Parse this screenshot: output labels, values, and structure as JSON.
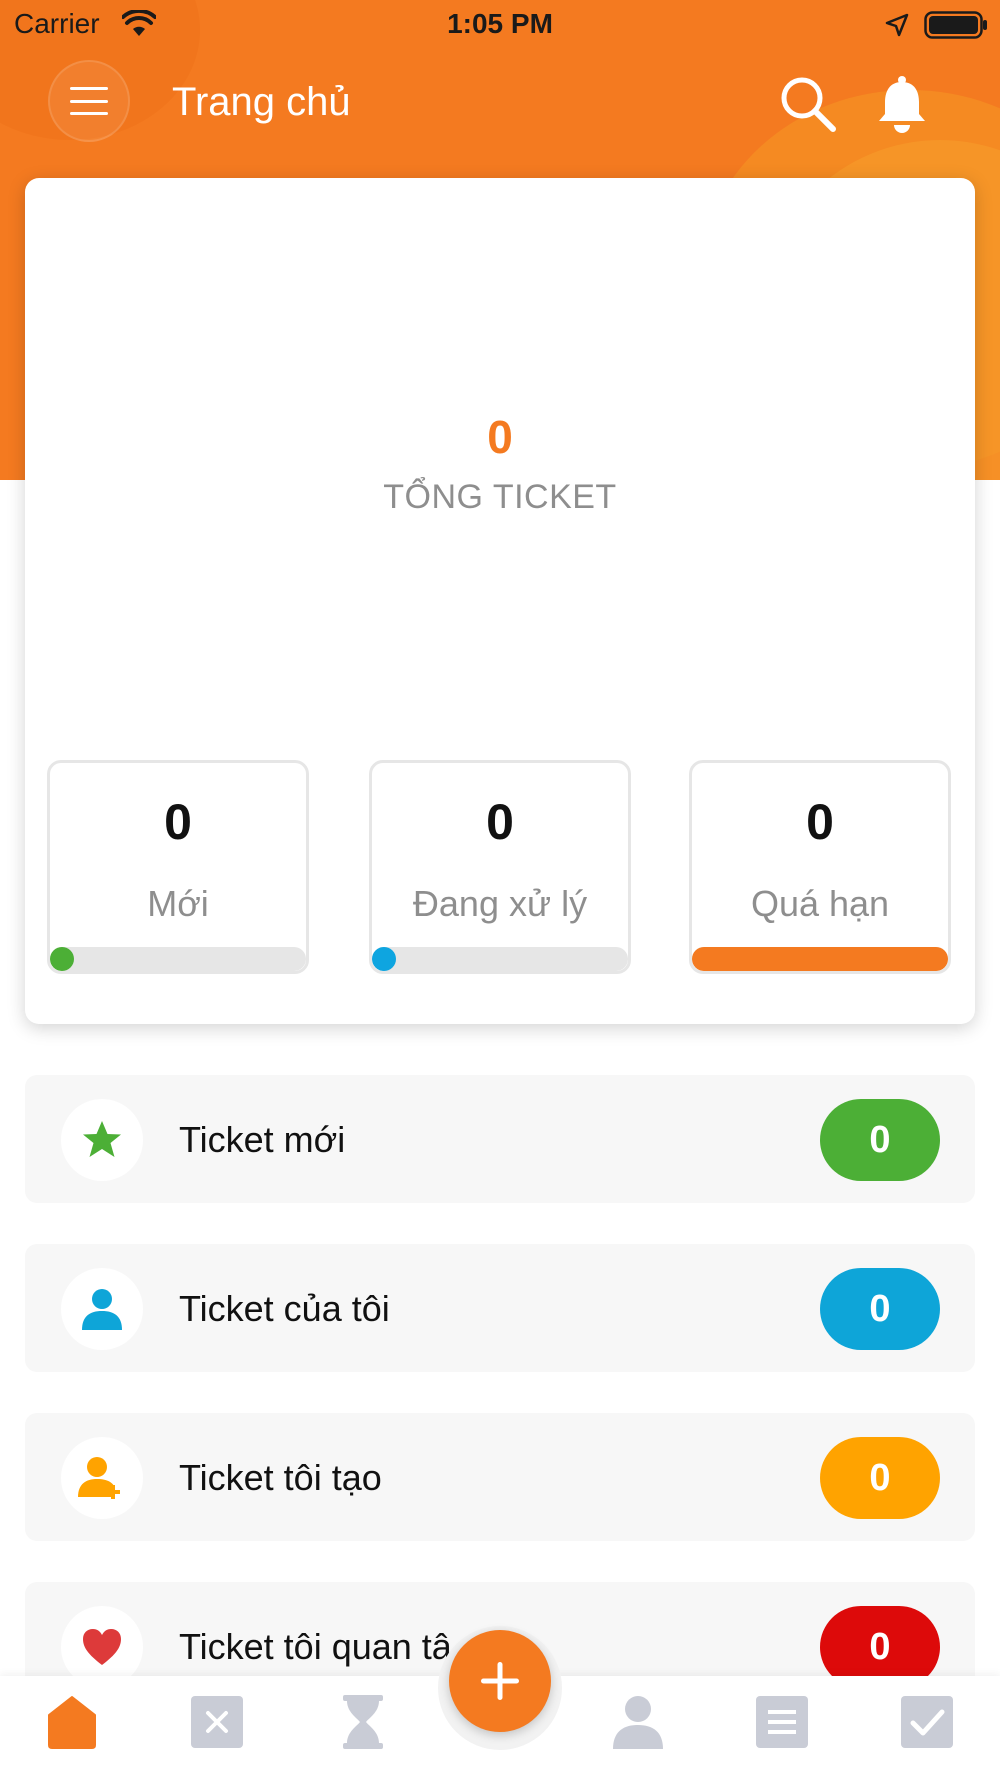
{
  "status_bar": {
    "carrier": "Carrier",
    "time": "1:05 PM"
  },
  "nav": {
    "title": "Trang chủ",
    "icons": [
      "menu-icon",
      "search-icon",
      "bell-icon"
    ]
  },
  "summary": {
    "total_value": "0",
    "total_label": "TỔNG TICKET",
    "stats": [
      {
        "value": "0",
        "label": "Mới",
        "color": "#4caf36",
        "fill_fraction": 0
      },
      {
        "value": "0",
        "label": "Đang xử lý",
        "color": "#0ea5e0",
        "fill_fraction": 0
      },
      {
        "value": "0",
        "label": "Quá hạn",
        "color": "#f47a20",
        "fill_fraction": 1
      }
    ]
  },
  "list": [
    {
      "label": "Ticket mới",
      "count": "0",
      "icon": "star-icon",
      "color": "#4caf36"
    },
    {
      "label": "Ticket của tôi",
      "count": "0",
      "icon": "user-icon",
      "color": "#0ea5d8"
    },
    {
      "label": "Ticket tôi tạo",
      "count": "0",
      "icon": "user-add-icon",
      "color": "#ffa300"
    },
    {
      "label": "Ticket tôi quan tâ",
      "count": "0",
      "icon": "heart-icon",
      "color": "#dd0a0a"
    }
  ],
  "tab_bar": {
    "tabs": [
      "home-icon",
      "close-icon",
      "hourglass-icon",
      "profile-icon",
      "list-icon",
      "checkmark-icon"
    ],
    "active_color": "#f47a20",
    "inactive_color": "#c9ccd6",
    "fab_icon": "plus-icon"
  }
}
